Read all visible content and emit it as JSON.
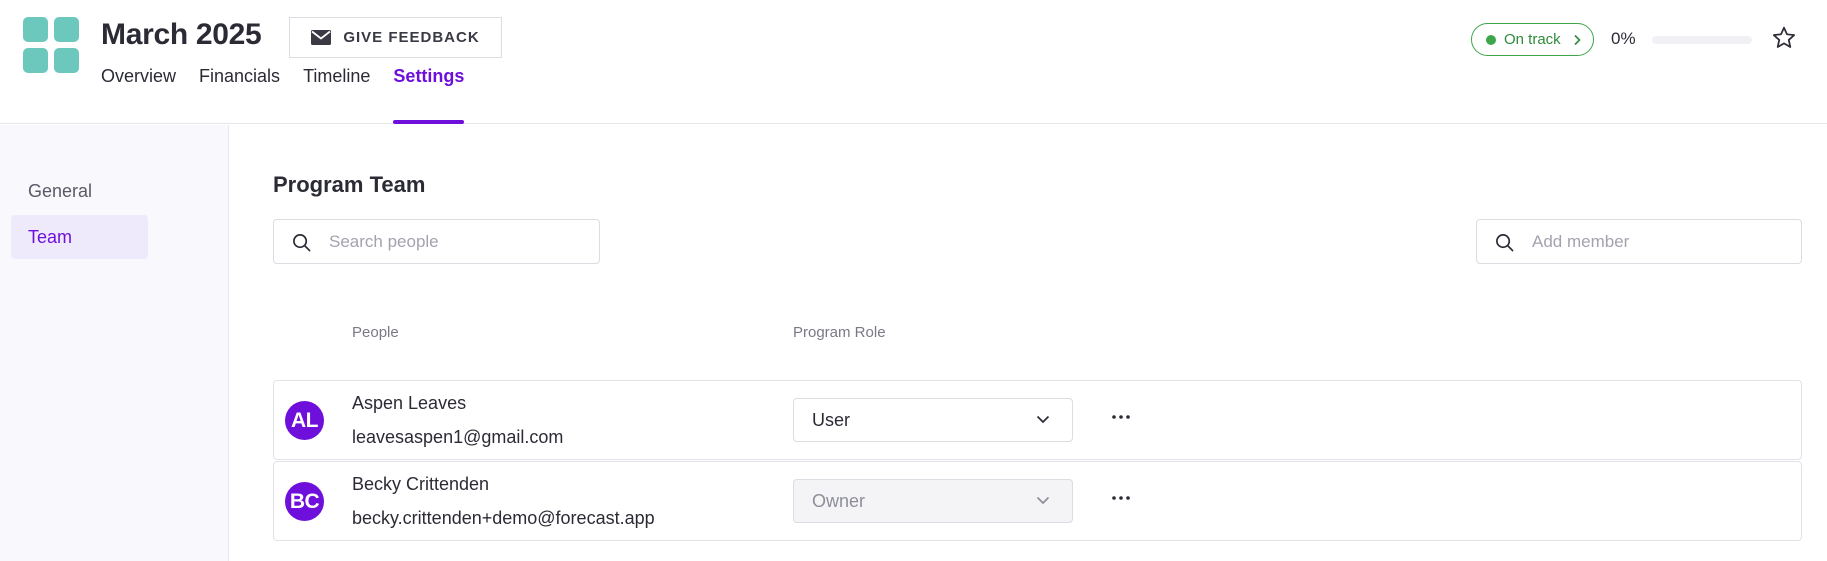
{
  "header": {
    "title": "March 2025",
    "feedback_label": "GIVE FEEDBACK",
    "tabs": [
      {
        "label": "Overview",
        "active": false
      },
      {
        "label": "Financials",
        "active": false
      },
      {
        "label": "Timeline",
        "active": false
      },
      {
        "label": "Settings",
        "active": true
      }
    ],
    "status": {
      "label": "On track",
      "color": "#3ea64a"
    },
    "progress": {
      "label": "0%",
      "value": 0
    },
    "accent_color": "#6e0fdc",
    "logo_color": "#6cc7bd"
  },
  "sidebar": {
    "items": [
      {
        "label": "General",
        "active": false
      },
      {
        "label": "Team",
        "active": true
      }
    ]
  },
  "main": {
    "section_title": "Program Team",
    "search_people": {
      "placeholder": "Search people",
      "value": ""
    },
    "add_member": {
      "placeholder": "Add member",
      "value": ""
    },
    "columns": {
      "people": "People",
      "role": "Program Role"
    },
    "members": [
      {
        "initials": "AL",
        "name": "Aspen Leaves",
        "email": "leavesaspen1@gmail.com",
        "role": "User",
        "role_disabled": false
      },
      {
        "initials": "BC",
        "name": "Becky Crittenden",
        "email": "becky.crittenden+demo@forecast.app",
        "role": "Owner",
        "role_disabled": true
      }
    ]
  },
  "icons": {
    "logo": "grid-logo-icon",
    "feedback": "envelope-icon",
    "status_chevron": "chevron-right-icon",
    "favorite": "star-icon",
    "search": "search-icon",
    "dropdown": "chevron-down-icon",
    "more": "more-horizontal-icon"
  }
}
